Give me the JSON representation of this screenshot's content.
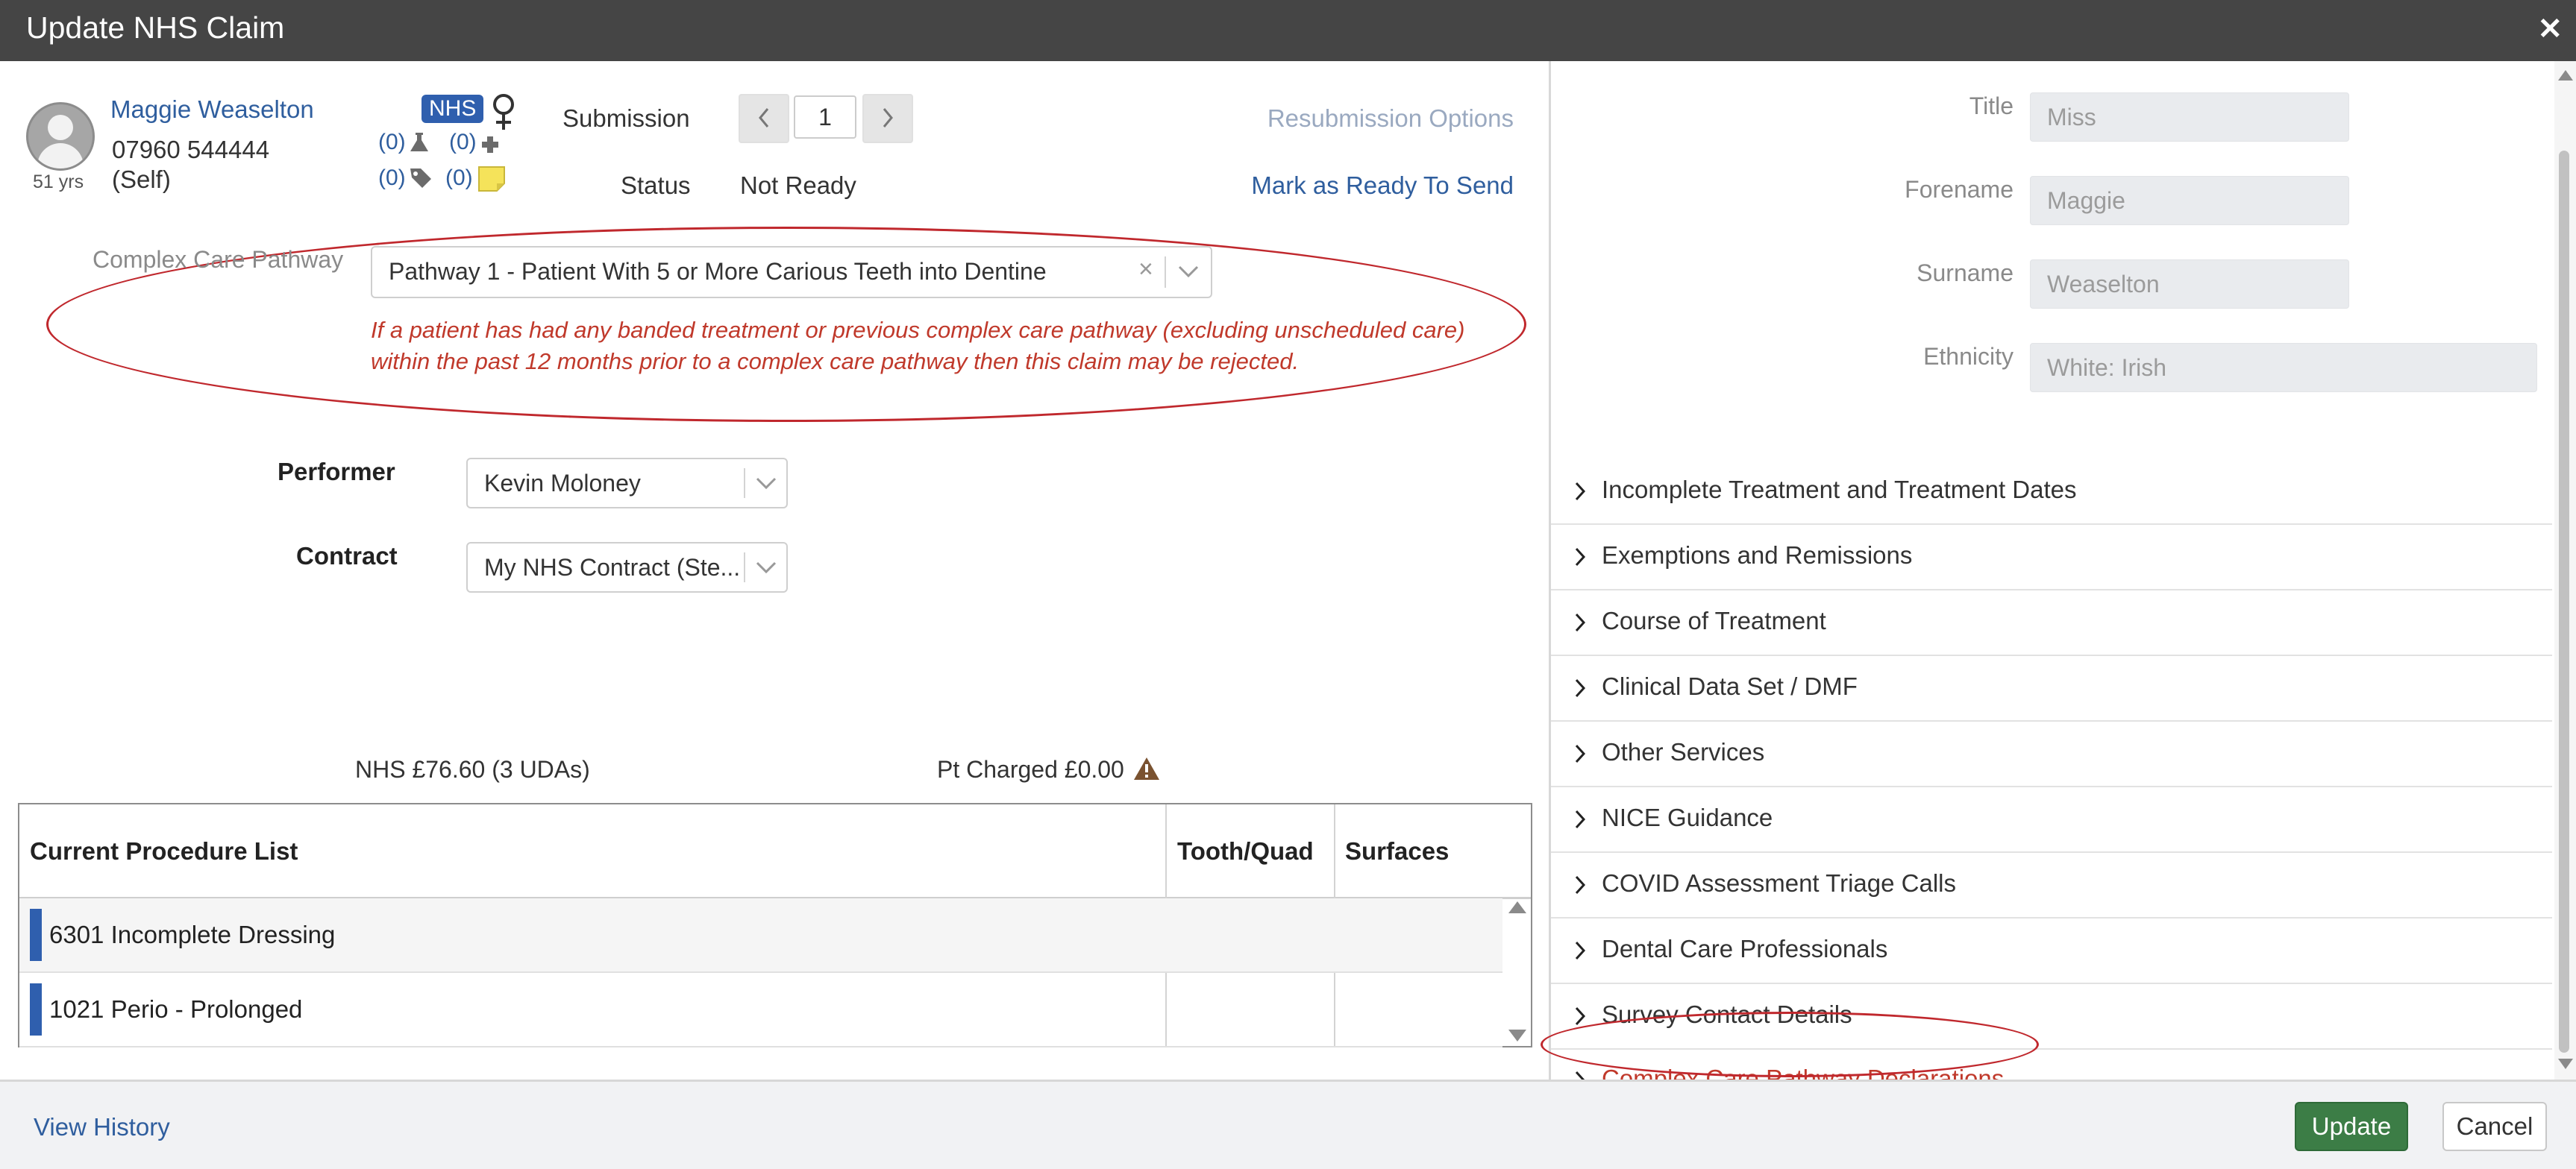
{
  "dialog": {
    "title": "Update NHS Claim"
  },
  "patient": {
    "name": "Maggie Weaselton",
    "phone": "07960 544444",
    "relation": "(Self)",
    "age": "51 yrs",
    "badge": "NHS",
    "counts": {
      "lab": "(0)",
      "medical": "(0)",
      "tags": "(0)",
      "notes": "(0)"
    }
  },
  "submission": {
    "label": "Submission",
    "number": "1",
    "resubmission_link": "Resubmission Options"
  },
  "status": {
    "label": "Status",
    "value": "Not Ready",
    "mark_ready_link": "Mark as Ready To Send"
  },
  "ccp": {
    "label": "Complex Care Pathway",
    "selected": "Pathway 1 - Patient With 5 or More Carious Teeth into Dentine",
    "clear_glyph": "×",
    "warning": "If a patient has had any banded treatment or previous complex care pathway (excluding unscheduled care) within the past 12 months prior to a complex care pathway then this claim may be rejected."
  },
  "performer": {
    "label": "Performer",
    "value": "Kevin Moloney"
  },
  "contract": {
    "label": "Contract",
    "value": "My NHS Contract (Ste..."
  },
  "totals": {
    "nhs": "NHS £76.60 (3 UDAs)",
    "pt_charged": "Pt Charged £0.00"
  },
  "procedures": {
    "headers": [
      "Current Procedure List",
      "Tooth/Quad",
      "Surfaces"
    ],
    "rows": [
      {
        "name": "6301 Incomplete Dressing",
        "tooth": "",
        "surfaces": ""
      },
      {
        "name": "1021 Perio - Prolonged",
        "tooth": "",
        "surfaces": ""
      }
    ]
  },
  "details": {
    "fields": [
      {
        "label": "Title",
        "value": "Miss"
      },
      {
        "label": "Forename",
        "value": "Maggie"
      },
      {
        "label": "Surname",
        "value": "Weaselton"
      },
      {
        "label": "Ethnicity",
        "value": "White: Irish"
      }
    ],
    "sections": [
      "Incomplete Treatment and Treatment Dates",
      "Exemptions and Remissions",
      "Course of Treatment",
      "Clinical Data Set / DMF",
      "Other Services",
      "NICE Guidance",
      "COVID Assessment Triage Calls",
      "Dental Care Professionals",
      "Survey Contact Details",
      "Complex Care Pathway Declarations"
    ]
  },
  "footer": {
    "view_history": "View History",
    "update": "Update",
    "cancel": "Cancel"
  },
  "colors": {
    "link": "#2f5e9e",
    "warning": "#c0392b",
    "primary": "#3c7d46",
    "titlebar": "#454545",
    "nhs_badge": "#2f5fae"
  }
}
